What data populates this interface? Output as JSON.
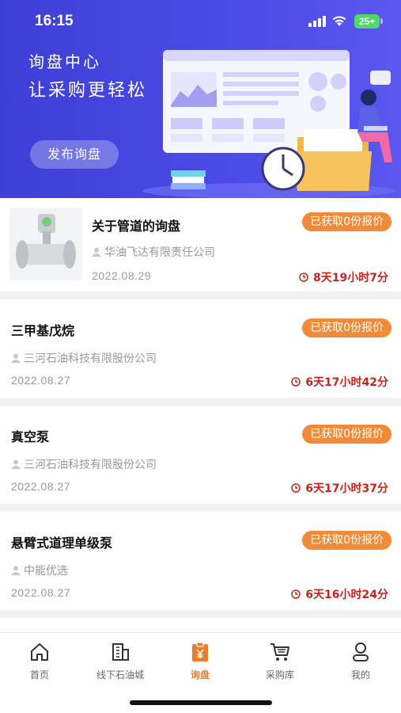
{
  "status_bar": {
    "time": "16:15",
    "battery": "25+"
  },
  "banner": {
    "title": "询盘中心",
    "subtitle": "让采购更轻松",
    "publish_label": "发布询盘"
  },
  "colors": {
    "accent": "#f18b3a",
    "countdown": "#c8231f",
    "banner": "#4545e0",
    "tab_active": "#ee7d2a"
  },
  "inquiries": [
    {
      "title": "关于管道的询盘",
      "badge": "已获取0份报价",
      "company": "华油飞达有限责任公司",
      "date": "2022.08.29",
      "countdown": "8天19小时7分",
      "has_image": true
    },
    {
      "title": "三甲基戊烷",
      "badge": "已获取0份报价",
      "company": "三河石油科技有限股份公司",
      "date": "2022.08.27",
      "countdown": "6天17小时42分"
    },
    {
      "title": "真空泵",
      "badge": "已获取0份报价",
      "company": "三河石油科技有限股份公司",
      "date": "2022.08.27",
      "countdown": "6天17小时37分"
    },
    {
      "title": "悬臂式道理单级泵",
      "badge": "已获取0份报价",
      "company": "中能优选",
      "date": "2022.08.27",
      "countdown": "6天16小时24分"
    }
  ],
  "tabbar": {
    "items": [
      {
        "label": "首页",
        "icon": "home-icon"
      },
      {
        "label": "线下石油城",
        "icon": "building-icon"
      },
      {
        "label": "询盘",
        "icon": "clipboard-yen-icon",
        "active": true
      },
      {
        "label": "采购库",
        "icon": "cart-icon"
      },
      {
        "label": "我的",
        "icon": "user-icon"
      }
    ]
  }
}
